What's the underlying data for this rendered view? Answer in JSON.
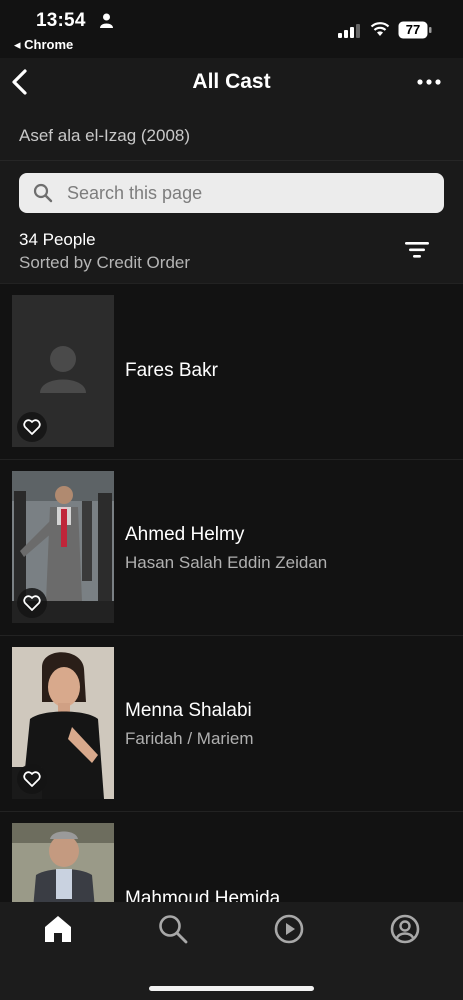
{
  "status_bar": {
    "time": "13:54",
    "back_app": "◂ Chrome",
    "battery": "77"
  },
  "header": {
    "title": "All Cast"
  },
  "movie": {
    "title": "Asef ala el-Izag (2008)"
  },
  "search": {
    "placeholder": "Search this page"
  },
  "list_meta": {
    "count": "34 People",
    "sort": "Sorted by Credit Order"
  },
  "cast": [
    {
      "name": "Fares Bakr",
      "role": ""
    },
    {
      "name": "Ahmed Helmy",
      "role": "Hasan Salah Eddin Zeidan"
    },
    {
      "name": "Menna Shalabi",
      "role": "Faridah / Mariem"
    },
    {
      "name": "Mahmoud Hemida",
      "role": ""
    }
  ],
  "tabs": [
    {
      "name": "home",
      "icon": "home-icon",
      "active": true
    },
    {
      "name": "search",
      "icon": "search-icon",
      "active": false
    },
    {
      "name": "video",
      "icon": "play-icon",
      "active": false
    },
    {
      "name": "profile",
      "icon": "profile-icon",
      "active": false
    }
  ],
  "colors": {
    "background": "#121212",
    "header": "#1a1a1a",
    "text_secondary": "#b0b0b0",
    "search_bg": "#ececec"
  }
}
